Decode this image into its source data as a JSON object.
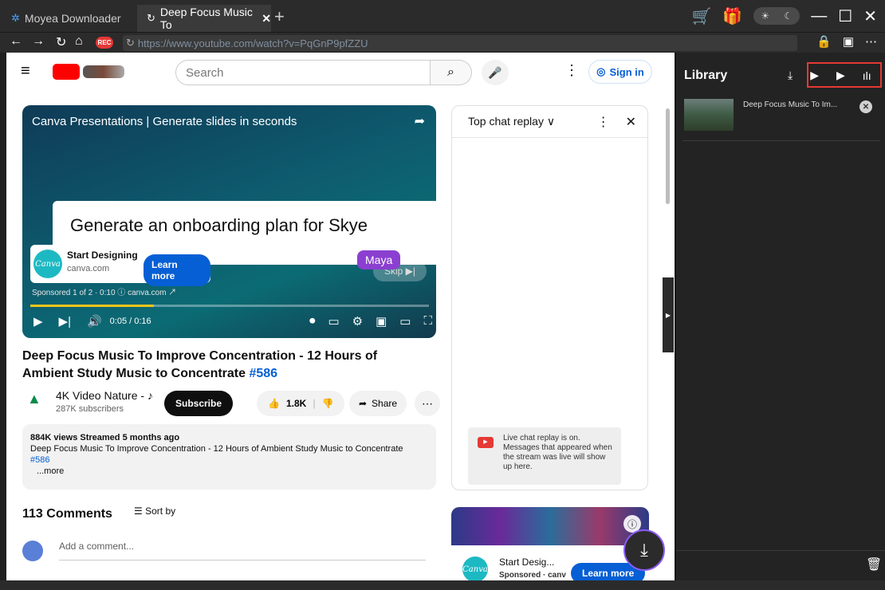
{
  "titlebar": {
    "tab1_label": "Moyea Downloader",
    "tab2_label": "Deep Focus Music To",
    "tab2_close": "✕",
    "new_tab": "+"
  },
  "addressbar": {
    "url": "https://www.youtube.com/watch?v=PqGnP9pfZZU",
    "rec": "REC"
  },
  "youtube": {
    "search_placeholder": "Search",
    "sign_in": "Sign in",
    "ad_header": "Canva Presentations | Generate slides in seconds",
    "ad_main_text": "Generate an onboarding plan for Skye",
    "maya": "Maya",
    "skip": "Skip ▶|",
    "brand_title": "Start Designing",
    "brand_url": "canva.com",
    "learn_more": "Learn more",
    "sponsored": "Sponsored 1 of 2 · 0:10 ⓘ canva.com ↗",
    "time": "0:05 / 0:16",
    "progress": 0.31,
    "title": "Deep Focus Music To Improve Concentration - 12 Hours of Ambient Study Music to Concentrate",
    "title_tag": "#586",
    "channel_name": "4K Video Nature - ♪",
    "subscribers": "287K subscribers",
    "subscribe": "Subscribe",
    "likes": "1.8K",
    "share": "Share",
    "desc_stats": "884K views  Streamed 5 months ago",
    "desc_text": "Deep Focus Music To Improve Concentration - 12 Hours of Ambient Study Music to Concentrate",
    "desc_tag": "#586",
    "desc_more": "...more",
    "comments": "113 Comments",
    "sort_by": "Sort by",
    "add_comment": "Add a comment...",
    "chat_title": "Top chat replay ∨",
    "chat_note": "Live chat replay is on. Messages that appeared when the stream was live will show up here.",
    "ad2_title": "Start Desig...",
    "ad2_sponsored": "Sponsored · canv",
    "ad2_learn": "Learn more",
    "canva": "Canva"
  },
  "library": {
    "title": "Library",
    "item_title": "Deep Focus Music To Im..."
  },
  "colors": {
    "accent": "#e53935",
    "link": "#065fd4"
  }
}
